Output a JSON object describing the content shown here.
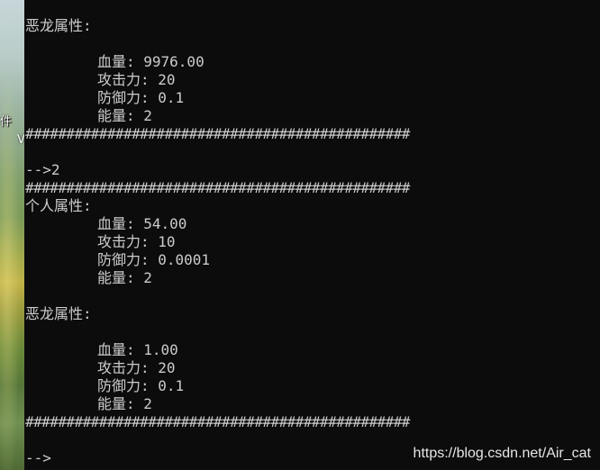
{
  "desktop": {
    "icon_label_1": "件",
    "icon_label_2": "V"
  },
  "console": {
    "lines": [
      "恶龙属性:",
      "血量: 9976.00",
      "攻击力: 20",
      "防御力: 0.1",
      "能量: 2",
      "###############################################",
      "-->2",
      "###############################################",
      "个人属性:",
      "血量: 54.00",
      "攻击力: 10",
      "防御力: 0.0001",
      "能量: 2",
      "恶龙属性:",
      "血量: 1.00",
      "攻击力: 20",
      "防御力: 0.1",
      "能量: 2",
      "###############################################",
      "-->"
    ]
  },
  "watermark": "https://blog.csdn.net/Air_cat",
  "colors": {
    "console_background": "#0c0c0c",
    "console_text": "#cccccc"
  }
}
